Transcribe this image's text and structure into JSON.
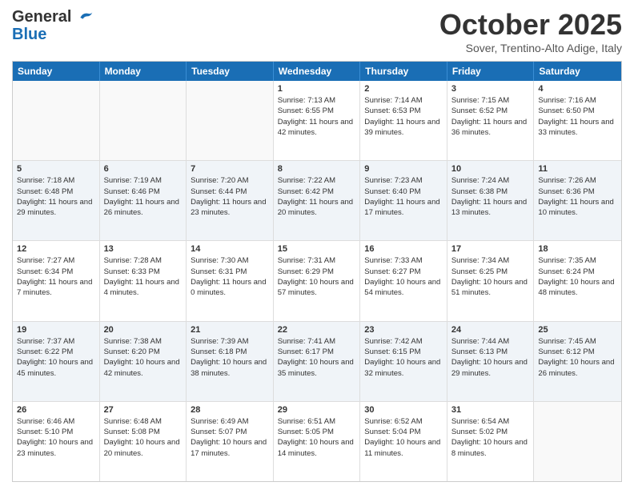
{
  "header": {
    "logo_line1": "General",
    "logo_line2": "Blue",
    "month": "October 2025",
    "location": "Sover, Trentino-Alto Adige, Italy"
  },
  "days_of_week": [
    "Sunday",
    "Monday",
    "Tuesday",
    "Wednesday",
    "Thursday",
    "Friday",
    "Saturday"
  ],
  "weeks": [
    [
      {
        "day": "",
        "info": ""
      },
      {
        "day": "",
        "info": ""
      },
      {
        "day": "",
        "info": ""
      },
      {
        "day": "1",
        "info": "Sunrise: 7:13 AM\nSunset: 6:55 PM\nDaylight: 11 hours and 42 minutes."
      },
      {
        "day": "2",
        "info": "Sunrise: 7:14 AM\nSunset: 6:53 PM\nDaylight: 11 hours and 39 minutes."
      },
      {
        "day": "3",
        "info": "Sunrise: 7:15 AM\nSunset: 6:52 PM\nDaylight: 11 hours and 36 minutes."
      },
      {
        "day": "4",
        "info": "Sunrise: 7:16 AM\nSunset: 6:50 PM\nDaylight: 11 hours and 33 minutes."
      }
    ],
    [
      {
        "day": "5",
        "info": "Sunrise: 7:18 AM\nSunset: 6:48 PM\nDaylight: 11 hours and 29 minutes."
      },
      {
        "day": "6",
        "info": "Sunrise: 7:19 AM\nSunset: 6:46 PM\nDaylight: 11 hours and 26 minutes."
      },
      {
        "day": "7",
        "info": "Sunrise: 7:20 AM\nSunset: 6:44 PM\nDaylight: 11 hours and 23 minutes."
      },
      {
        "day": "8",
        "info": "Sunrise: 7:22 AM\nSunset: 6:42 PM\nDaylight: 11 hours and 20 minutes."
      },
      {
        "day": "9",
        "info": "Sunrise: 7:23 AM\nSunset: 6:40 PM\nDaylight: 11 hours and 17 minutes."
      },
      {
        "day": "10",
        "info": "Sunrise: 7:24 AM\nSunset: 6:38 PM\nDaylight: 11 hours and 13 minutes."
      },
      {
        "day": "11",
        "info": "Sunrise: 7:26 AM\nSunset: 6:36 PM\nDaylight: 11 hours and 10 minutes."
      }
    ],
    [
      {
        "day": "12",
        "info": "Sunrise: 7:27 AM\nSunset: 6:34 PM\nDaylight: 11 hours and 7 minutes."
      },
      {
        "day": "13",
        "info": "Sunrise: 7:28 AM\nSunset: 6:33 PM\nDaylight: 11 hours and 4 minutes."
      },
      {
        "day": "14",
        "info": "Sunrise: 7:30 AM\nSunset: 6:31 PM\nDaylight: 11 hours and 0 minutes."
      },
      {
        "day": "15",
        "info": "Sunrise: 7:31 AM\nSunset: 6:29 PM\nDaylight: 10 hours and 57 minutes."
      },
      {
        "day": "16",
        "info": "Sunrise: 7:33 AM\nSunset: 6:27 PM\nDaylight: 10 hours and 54 minutes."
      },
      {
        "day": "17",
        "info": "Sunrise: 7:34 AM\nSunset: 6:25 PM\nDaylight: 10 hours and 51 minutes."
      },
      {
        "day": "18",
        "info": "Sunrise: 7:35 AM\nSunset: 6:24 PM\nDaylight: 10 hours and 48 minutes."
      }
    ],
    [
      {
        "day": "19",
        "info": "Sunrise: 7:37 AM\nSunset: 6:22 PM\nDaylight: 10 hours and 45 minutes."
      },
      {
        "day": "20",
        "info": "Sunrise: 7:38 AM\nSunset: 6:20 PM\nDaylight: 10 hours and 42 minutes."
      },
      {
        "day": "21",
        "info": "Sunrise: 7:39 AM\nSunset: 6:18 PM\nDaylight: 10 hours and 38 minutes."
      },
      {
        "day": "22",
        "info": "Sunrise: 7:41 AM\nSunset: 6:17 PM\nDaylight: 10 hours and 35 minutes."
      },
      {
        "day": "23",
        "info": "Sunrise: 7:42 AM\nSunset: 6:15 PM\nDaylight: 10 hours and 32 minutes."
      },
      {
        "day": "24",
        "info": "Sunrise: 7:44 AM\nSunset: 6:13 PM\nDaylight: 10 hours and 29 minutes."
      },
      {
        "day": "25",
        "info": "Sunrise: 7:45 AM\nSunset: 6:12 PM\nDaylight: 10 hours and 26 minutes."
      }
    ],
    [
      {
        "day": "26",
        "info": "Sunrise: 6:46 AM\nSunset: 5:10 PM\nDaylight: 10 hours and 23 minutes."
      },
      {
        "day": "27",
        "info": "Sunrise: 6:48 AM\nSunset: 5:08 PM\nDaylight: 10 hours and 20 minutes."
      },
      {
        "day": "28",
        "info": "Sunrise: 6:49 AM\nSunset: 5:07 PM\nDaylight: 10 hours and 17 minutes."
      },
      {
        "day": "29",
        "info": "Sunrise: 6:51 AM\nSunset: 5:05 PM\nDaylight: 10 hours and 14 minutes."
      },
      {
        "day": "30",
        "info": "Sunrise: 6:52 AM\nSunset: 5:04 PM\nDaylight: 10 hours and 11 minutes."
      },
      {
        "day": "31",
        "info": "Sunrise: 6:54 AM\nSunset: 5:02 PM\nDaylight: 10 hours and 8 minutes."
      },
      {
        "day": "",
        "info": ""
      }
    ]
  ]
}
